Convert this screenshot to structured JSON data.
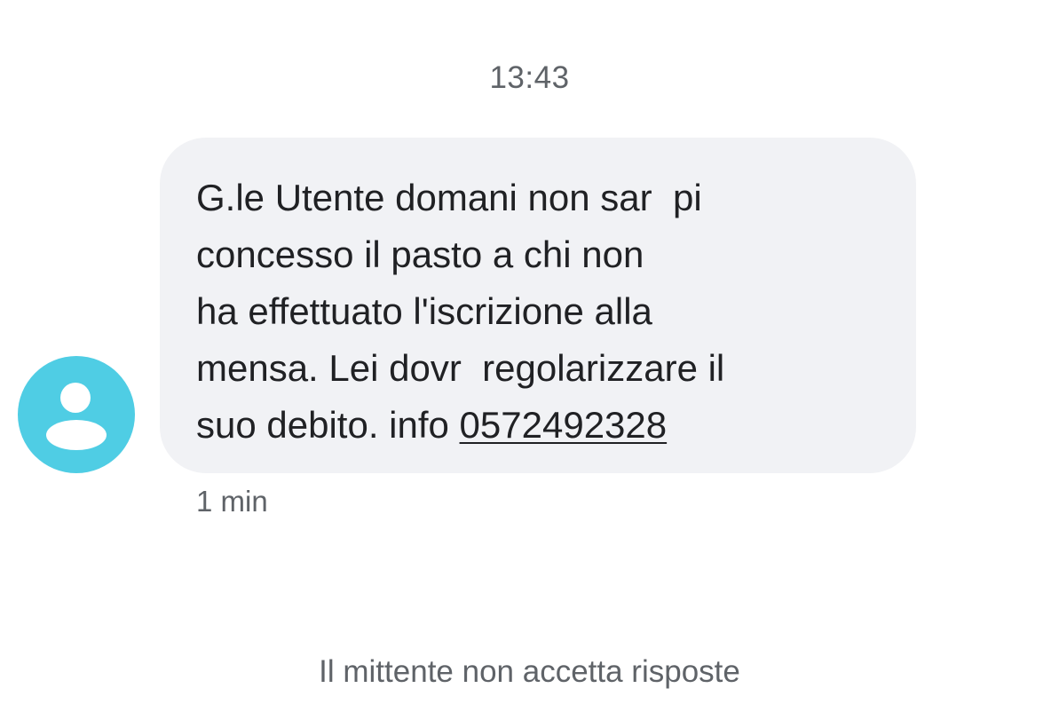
{
  "conversation": {
    "time_header": "13:43",
    "message": {
      "lines": [
        "G.le Utente domani non sar  pi",
        "concesso il pasto a chi non",
        "ha effettuato l'iscrizione alla",
        "mensa. Lei dovr  regolarizzare il"
      ],
      "last_line_prefix": "suo debito. info ",
      "phone_link": "0572492328",
      "time_ago": "1 min"
    },
    "sender": {
      "avatar_icon": "person-icon",
      "avatar_color": "#4fcde4"
    },
    "footer_note": "Il mittente non accetta risposte"
  }
}
